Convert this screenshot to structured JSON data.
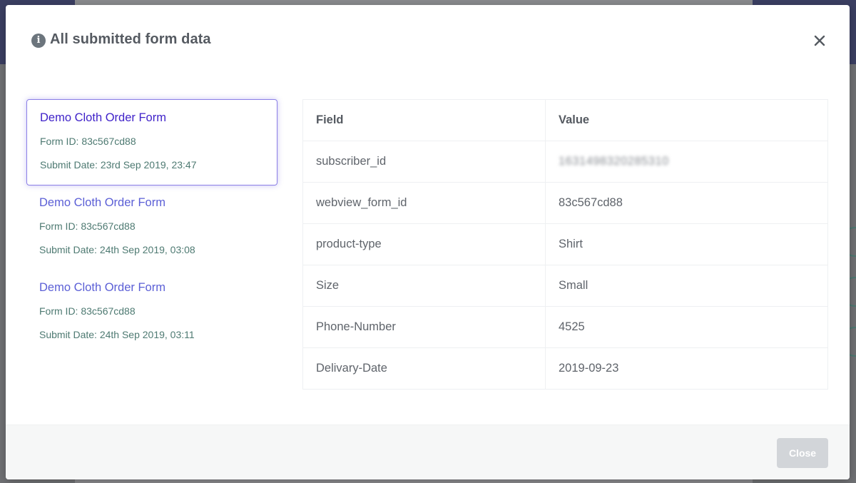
{
  "modal": {
    "title": "All submitted form data",
    "icon": "info-icon",
    "close_icon": "close-icon",
    "footer_button": "Close"
  },
  "forms": [
    {
      "title": "Demo Cloth Order Form",
      "form_id": "Form ID: 83c567cd88",
      "submit_date": "Submit Date: 23rd Sep 2019, 23:47",
      "active": true
    },
    {
      "title": "Demo Cloth Order Form",
      "form_id": "Form ID: 83c567cd88",
      "submit_date": "Submit Date: 24th Sep 2019, 03:08",
      "active": false
    },
    {
      "title": "Demo Cloth Order Form",
      "form_id": "Form ID: 83c567cd88",
      "submit_date": "Submit Date: 24th Sep 2019, 03:11",
      "active": false
    }
  ],
  "table": {
    "headers": [
      "Field",
      "Value"
    ],
    "rows": [
      {
        "field": "subscriber_id",
        "value": "1631498320285310",
        "blurred": true
      },
      {
        "field": "webview_form_id",
        "value": "83c567cd88"
      },
      {
        "field": "product-type",
        "value": "Shirt"
      },
      {
        "field": "Size",
        "value": "Small"
      },
      {
        "field": "Phone-Number",
        "value": "4525"
      },
      {
        "field": "Delivary-Date",
        "value": "2019-09-23"
      }
    ]
  },
  "colors": {
    "active_title": "#3f22c9",
    "item_title": "#5b5fd6",
    "meta_text": "#4e7a72",
    "active_border": "#8b7fe6",
    "close_button_bg": "#d2d5d9"
  }
}
